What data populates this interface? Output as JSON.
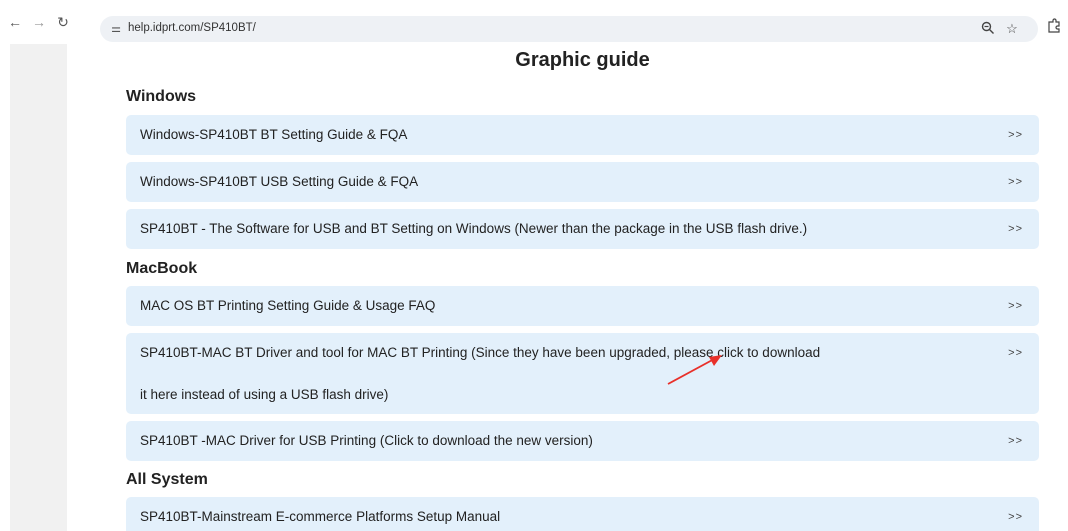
{
  "browser": {
    "url": "help.idprt.com/SP410BT/"
  },
  "page": {
    "title": "Graphic guide",
    "sections": [
      {
        "heading": "Windows",
        "items": [
          {
            "label": "Windows-SP410BT BT Setting Guide & FQA",
            "arrow": ">>"
          },
          {
            "label": "Windows-SP410BT USB Setting Guide & FQA",
            "arrow": ">>"
          },
          {
            "label": "SP410BT - The Software for USB and BT Setting on Windows   (Newer than the package in the USB flash drive.)",
            "arrow": ">>"
          }
        ]
      },
      {
        "heading": "MacBook",
        "items": [
          {
            "label": "MAC OS BT Printing Setting Guide & Usage FAQ",
            "arrow": ">>"
          },
          {
            "label": "SP410BT-MAC BT Driver and tool for MAC BT Printing (Since they have been upgraded, please click to download",
            "label_line2": "it here instead of using a USB flash drive)",
            "arrow": ">>"
          },
          {
            "label": "SP410BT -MAC Driver for USB Printing (Click to download the new version)",
            "arrow": ">>"
          }
        ]
      },
      {
        "heading": "All System",
        "items": [
          {
            "label": "SP410BT-Mainstream E-commerce Platforms Setup Manual",
            "arrow": ">>"
          }
        ]
      }
    ]
  },
  "colors": {
    "item_background": "#e3f0fb",
    "annotation_arrow": "#e8302a"
  }
}
